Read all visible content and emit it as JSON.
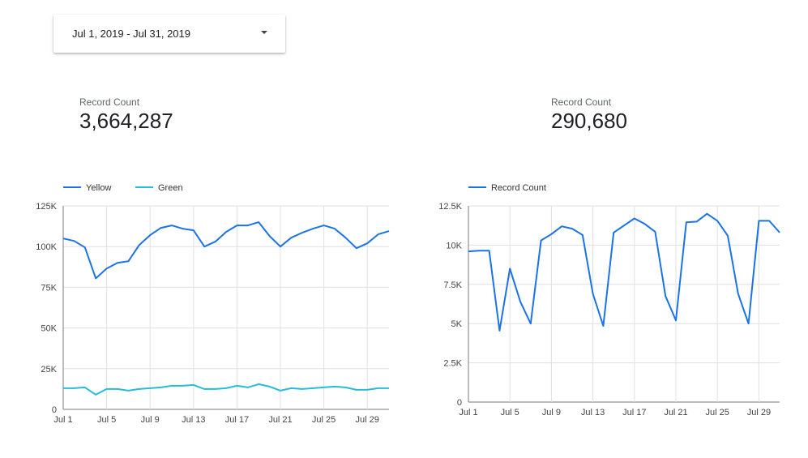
{
  "date_range": {
    "label": "Jul 1, 2019 - Jul 31, 2019"
  },
  "scorecards": [
    {
      "label": "Record Count",
      "value": "3,664,287"
    },
    {
      "label": "Record Count",
      "value": "290,680"
    }
  ],
  "colors": {
    "series_blue": "#1a73e8",
    "series_teal": "#27bcd8",
    "grid": "#e0e0e0",
    "axis": "#7a7a7a"
  },
  "chart_data": [
    {
      "type": "line",
      "title": "",
      "xlabel": "",
      "ylabel": "",
      "legend_position": "top-left",
      "x": [
        1,
        2,
        3,
        4,
        5,
        6,
        7,
        8,
        9,
        10,
        11,
        12,
        13,
        14,
        15,
        16,
        17,
        18,
        19,
        20,
        21,
        22,
        23,
        24,
        25,
        26,
        27,
        28,
        29,
        30,
        31
      ],
      "x_ticks": [
        "Jul 1",
        "Jul 5",
        "Jul 9",
        "Jul 13",
        "Jul 17",
        "Jul 21",
        "Jul 25",
        "Jul 29"
      ],
      "x_tick_days": [
        1,
        5,
        9,
        13,
        17,
        21,
        25,
        29
      ],
      "y_ticks": [
        "0",
        "25K",
        "50K",
        "75K",
        "100K",
        "125K"
      ],
      "ylim": [
        0,
        125000
      ],
      "grid": true,
      "series": [
        {
          "name": "Yellow",
          "color": "#1a73e8",
          "values": [
            105000,
            103500,
            99500,
            80500,
            86500,
            90000,
            91000,
            101000,
            107000,
            111500,
            113000,
            111000,
            110000,
            100000,
            103000,
            109000,
            113000,
            113000,
            115000,
            106500,
            100000,
            105500,
            108500,
            111000,
            113000,
            111000,
            105500,
            99000,
            102000,
            107500,
            109500
          ]
        },
        {
          "name": "Green",
          "color": "#27bcd8",
          "values": [
            13000,
            13000,
            13500,
            9000,
            12500,
            12500,
            11500,
            12500,
            13000,
            13500,
            14500,
            14500,
            15000,
            12500,
            12500,
            13000,
            14500,
            13500,
            15500,
            14000,
            11500,
            13000,
            12500,
            13000,
            13500,
            14000,
            13500,
            12000,
            12000,
            13000,
            13000
          ]
        }
      ]
    },
    {
      "type": "line",
      "title": "",
      "xlabel": "",
      "ylabel": "",
      "legend_position": "top-left",
      "x": [
        1,
        2,
        3,
        4,
        5,
        6,
        7,
        8,
        9,
        10,
        11,
        12,
        13,
        14,
        15,
        16,
        17,
        18,
        19,
        20,
        21,
        22,
        23,
        24,
        25,
        26,
        27,
        28,
        29,
        30,
        31
      ],
      "x_ticks": [
        "Jul 1",
        "Jul 5",
        "Jul 9",
        "Jul 13",
        "Jul 17",
        "Jul 21",
        "Jul 25",
        "Jul 29"
      ],
      "x_tick_days": [
        1,
        5,
        9,
        13,
        17,
        21,
        25,
        29
      ],
      "y_ticks": [
        "0",
        "2.5K",
        "5K",
        "7.5K",
        "10K",
        "12.5K"
      ],
      "ylim": [
        0,
        12500
      ],
      "grid": true,
      "series": [
        {
          "name": "Record Count",
          "color": "#1a73e8",
          "values": [
            9600,
            9650,
            9650,
            4550,
            8500,
            6400,
            5000,
            10300,
            10700,
            11200,
            11050,
            10650,
            6900,
            4850,
            10800,
            11250,
            11700,
            11350,
            10850,
            6750,
            5200,
            11450,
            11500,
            12000,
            11550,
            10600,
            6900,
            5000,
            11550,
            11550,
            10800
          ]
        }
      ]
    }
  ]
}
